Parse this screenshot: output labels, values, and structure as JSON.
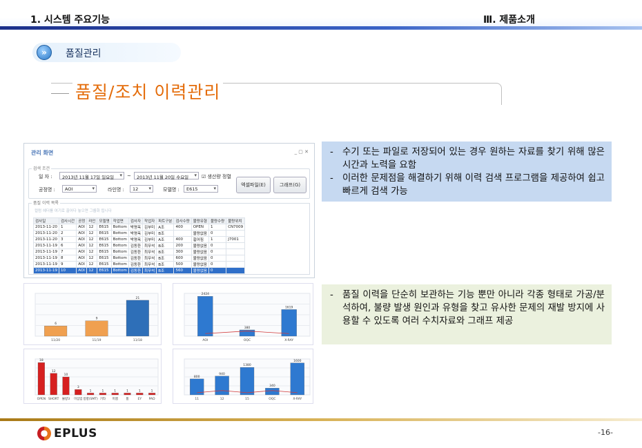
{
  "header": {
    "left": "1. 시스템 주요기능",
    "right": "Ⅲ. 제품소개"
  },
  "section": {
    "label": "품질관리"
  },
  "page_title": "품질/조치 이력관리",
  "app": {
    "window_title": "관리 화면",
    "search_group": "검색 조건",
    "date_label": "일 자 :",
    "date_from": "2013년 11월 17일 일요일",
    "date_to": "2013년 11월 20일 수요일",
    "tilde": "~",
    "prod_check": "생산량 정렬",
    "process_label": "공정명 :",
    "process_value": "AOI",
    "line_label": "라인명 :",
    "line_value": "12",
    "model_label": "모델명 :",
    "model_value": "E615",
    "excel_button": "엑셀파일(E)",
    "graph_button": "그래프(G)",
    "grid_group": "품질 이력 목록",
    "grid_hint": "컬럼 헤더를 여기로 끌어다 놓으면 그룹화 됩니다",
    "columns": [
      "검사일",
      "검사시간",
      "공정",
      "라인",
      "모델명",
      "작업면",
      "검사자",
      "작업자",
      "파트구분",
      "검사수량",
      "불량유형",
      "불량수량",
      "불량위치"
    ],
    "rows": [
      [
        "2013-11-20",
        "1",
        "AOI",
        "12",
        "E615",
        "Bottom",
        "박명옥",
        "김부미",
        "A조",
        "400",
        "OPEN",
        "1",
        "CN7009"
      ],
      [
        "2013-11-20",
        "2",
        "AOI",
        "12",
        "E615",
        "Bottom",
        "박명옥",
        "김부미",
        "B조",
        "",
        "불량없음",
        "0",
        ""
      ],
      [
        "2013-11-20",
        "3",
        "AOI",
        "12",
        "E615",
        "Bottom",
        "박명옥",
        "김부미",
        "A조",
        "400",
        "휨어짐",
        "1",
        "J7001"
      ],
      [
        "2013-11-19",
        "6",
        "AOI",
        "12",
        "E615",
        "Bottom",
        "김동환",
        "최무석",
        "B조",
        "200",
        "불량없음",
        "0",
        ""
      ],
      [
        "2013-11-19",
        "7",
        "AOI",
        "12",
        "E615",
        "Bottom",
        "김동환",
        "최무석",
        "B조",
        "300",
        "불량없음",
        "0",
        ""
      ],
      [
        "2013-11-19",
        "8",
        "AOI",
        "12",
        "E615",
        "Bottom",
        "김동환",
        "최무석",
        "B조",
        "600",
        "불량없음",
        "0",
        ""
      ],
      [
        "2013-11-19",
        "9",
        "AOI",
        "12",
        "E615",
        "Bottom",
        "김동환",
        "최무석",
        "B조",
        "500",
        "불량없음",
        "0",
        ""
      ],
      [
        "2013-11-19",
        "10",
        "AOI",
        "12",
        "E615",
        "Bottom",
        "김동환",
        "최무석",
        "B조",
        "560",
        "불량없음",
        "0",
        ""
      ]
    ],
    "selected_row": 7
  },
  "desc1": [
    "수기 또는 파일로 저장되어 있는 경우 원하는 자료를 찾기 위해 많은 시간과 노력을 요함",
    "이러한 문제점을 해결하기 위해 이력 검색 프로그램을 제공하여 쉽고 빠르게 검색 가능"
  ],
  "desc2": [
    "품질 이력을 단순히 보관하는 기능 뿐만 아니라 각종 형태로 가공/분석하여, 불량 발생 원인과 유형을 찾고 유사한 문제의 재발 방지에 사용할 수 있도록 여러 수치자료와 그래프 제공"
  ],
  "chart_data": [
    {
      "type": "bar",
      "title": "",
      "categories": [
        "11/20",
        "11/19",
        "11/18"
      ],
      "values": [
        6,
        9,
        21
      ],
      "ylim": [
        0,
        25
      ],
      "colors": [
        "#f0a050",
        "#f0a050",
        "#2e6fb8"
      ]
    },
    {
      "type": "bar",
      "title": "",
      "categories": [
        "AOI",
        "OQC",
        "X-RAY"
      ],
      "values": [
        2424,
        380,
        1619
      ],
      "ylim": [
        0,
        2600
      ],
      "colors": [
        "#2e79d0",
        "#2e79d0",
        "#2e79d0"
      ]
    },
    {
      "type": "bar",
      "title": "",
      "categories": [
        "OPEN",
        "SHORT",
        "불량3",
        "미삽입",
        "방향(SMT)",
        "기타",
        "미땜",
        "휨",
        "EY",
        "PAD"
      ],
      "values": [
        18,
        12,
        10,
        3,
        1,
        1,
        1,
        1,
        1,
        1
      ],
      "ylim": [
        0,
        20
      ],
      "colors": [
        "#d62020"
      ]
    },
    {
      "type": "bar",
      "title": "",
      "categories": [
        "11",
        "12",
        "15",
        "OQC",
        "X-RAY"
      ],
      "values": [
        800,
        940,
        1380,
        340,
        1600
      ],
      "ylim": [
        0,
        1800
      ],
      "colors": [
        "#2e79d0"
      ]
    }
  ],
  "footer": {
    "logo": "EPLUS",
    "page": "-16-"
  }
}
